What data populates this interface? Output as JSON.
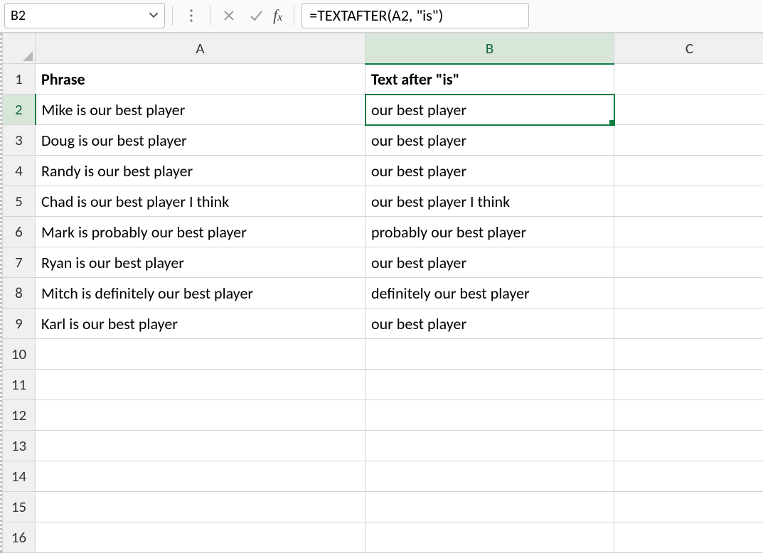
{
  "name_box": "B2",
  "formula": "=TEXTAFTER(A2, \"is\")",
  "columns": [
    "A",
    "B",
    "C"
  ],
  "row_numbers": [
    1,
    2,
    3,
    4,
    5,
    6,
    7,
    8,
    9,
    10,
    11,
    12,
    13,
    14,
    15,
    16
  ],
  "active_cell": "B2",
  "headers": {
    "A": "Phrase",
    "B": "Text after \"is\""
  },
  "rows": [
    {
      "A": "Mike is our best player",
      "B": " our best player"
    },
    {
      "A": "Doug is our best player",
      "B": " our best player"
    },
    {
      "A": "Randy is our best player",
      "B": " our best player"
    },
    {
      "A": "Chad is our best player I think",
      "B": " our best player I think"
    },
    {
      "A": "Mark is probably our best player",
      "B": " probably our best player"
    },
    {
      "A": "Ryan is our best player",
      "B": " our best player"
    },
    {
      "A": "Mitch is definitely our best player",
      "B": " definitely our best player"
    },
    {
      "A": "Karl is our best player",
      "B": " our best player"
    }
  ]
}
